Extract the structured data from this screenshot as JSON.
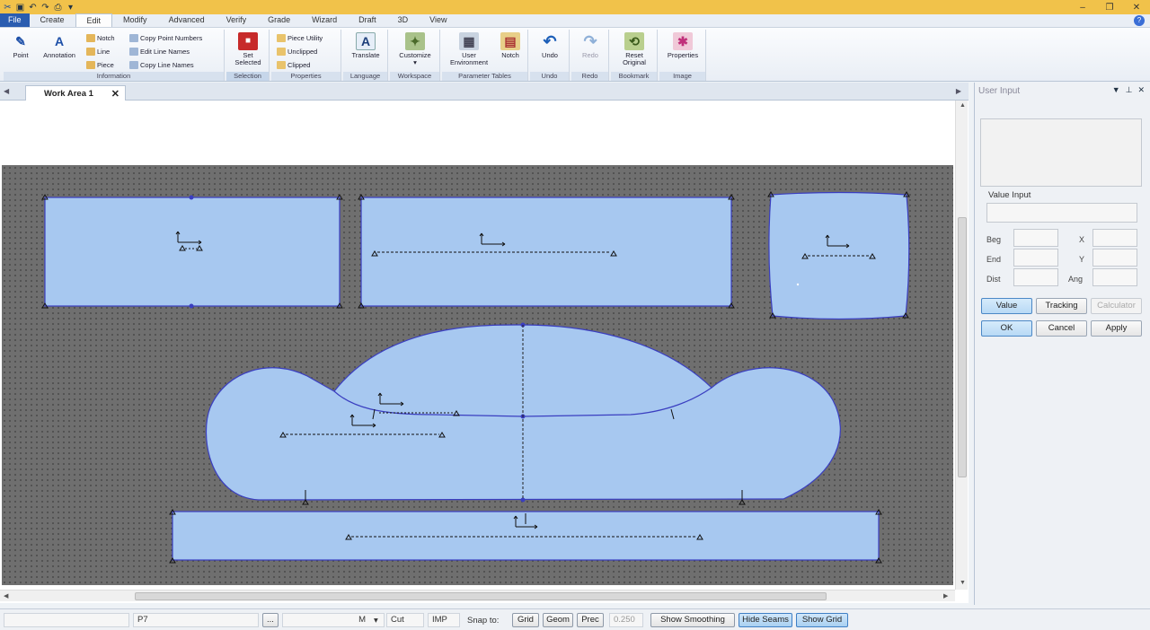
{
  "app": {
    "window_controls": {
      "minimize": "–",
      "restore": "❐",
      "close": "✕"
    }
  },
  "menu": {
    "tabs": [
      "File",
      "Create",
      "Edit",
      "Modify",
      "Advanced",
      "Verify",
      "Grade",
      "Wizard",
      "Draft",
      "3D",
      "View"
    ],
    "active": "Edit"
  },
  "ribbon": {
    "groups": {
      "information": "Information",
      "selection": "Selection",
      "properties": "Properties",
      "language": "Language",
      "workspace": "Workspace",
      "parameter_tables": "Parameter Tables",
      "undo": "Undo",
      "redo": "Redo",
      "bookmark": "Bookmark",
      "image": "Image"
    },
    "buttons": {
      "point": "Point",
      "annotation": "Annotation",
      "notch": "Notch",
      "line": "Line",
      "piece": "Piece",
      "copy_point_numbers": "Copy Point Numbers",
      "edit_line_names": "Edit Line Names",
      "copy_line_names": "Copy Line Names",
      "set_selected_1": "Set",
      "set_selected_2": "Selected",
      "piece_utility": "Piece Utility",
      "unclipped": "Unclipped",
      "clipped": "Clipped",
      "translate": "Translate",
      "customize": "Customize",
      "user_env_1": "User",
      "user_env_2": "Environment",
      "notch2": "Notch",
      "undo": "Undo",
      "redo": "Redo",
      "reset_1": "Reset",
      "reset_2": "Original",
      "properties": "Properties"
    }
  },
  "document": {
    "tab_label": "Work Area 1",
    "close_glyph": "✕"
  },
  "user_input": {
    "title": "User Input",
    "value_input_label": "Value Input",
    "fields": {
      "beg": "Beg",
      "end": "End",
      "dist": "Dist",
      "x": "X",
      "y": "Y",
      "ang": "Ang"
    },
    "buttons": {
      "value": "Value",
      "tracking": "Tracking",
      "calculator": "Calculator",
      "ok": "OK",
      "cancel": "Cancel",
      "apply": "Apply"
    }
  },
  "status": {
    "piece_id": "P7",
    "ellipsis": "...",
    "unit": "M",
    "cut": "Cut",
    "imp": "IMP",
    "snap_to": "Snap to:",
    "grid": "Grid",
    "geom": "Geom",
    "prec": "Prec",
    "prec_value": "0.250",
    "show_smoothing": "Show Smoothing",
    "hide_seams": "Hide Seams",
    "show_grid": "Show Grid"
  },
  "colors": {
    "piece_fill": "#a7c8f0",
    "piece_stroke": "#3a3ec0",
    "canvas_bg": "#6f6f6f",
    "titlebar": "#f1c24a",
    "file_tab": "#2a5db0"
  }
}
